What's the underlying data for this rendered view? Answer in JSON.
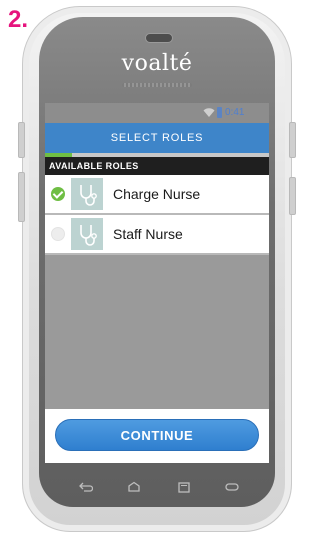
{
  "step_label": "2.",
  "device": {
    "brand": "voalté"
  },
  "status_bar": {
    "time": "0:41",
    "icons": [
      "wifi-icon",
      "battery-icon"
    ]
  },
  "app": {
    "title": "SELECT ROLES",
    "progress": 0.12,
    "section_header": "AVAILABLE ROLES",
    "roles": [
      {
        "label": "Charge Nurse",
        "selected": true,
        "icon": "stethoscope-icon"
      },
      {
        "label": "Staff Nurse",
        "selected": false,
        "icon": "stethoscope-icon"
      }
    ],
    "continue_label": "CONTINUE"
  },
  "nav_buttons": [
    "back-icon",
    "home-icon",
    "recent-apps-icon",
    "menu-icon"
  ],
  "colors": {
    "accent": "#e6137d",
    "app_bar": "#3e85c9",
    "progress": "#6fbe44",
    "button": "#3b8cd8"
  }
}
